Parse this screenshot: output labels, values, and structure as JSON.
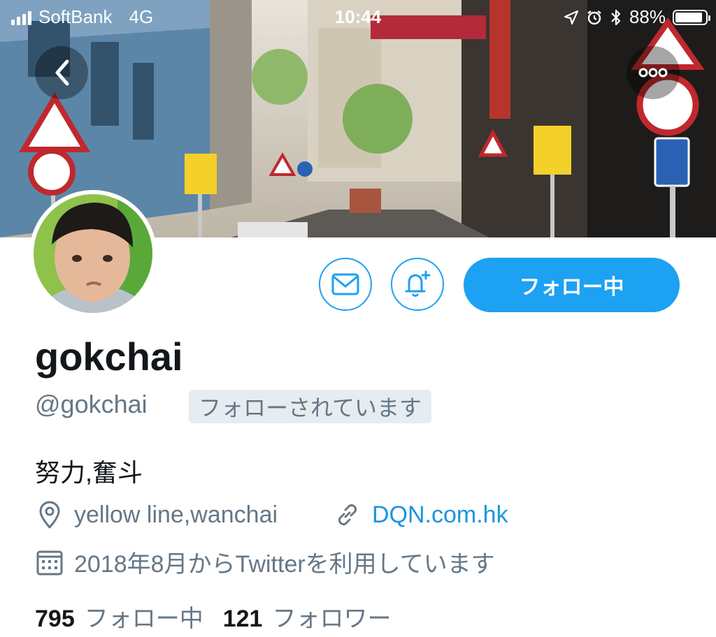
{
  "status_bar": {
    "carrier": "SoftBank",
    "network": "4G",
    "time": "10:44",
    "battery": "88%"
  },
  "profile": {
    "name": "gokchai",
    "handle": "@gokchai",
    "follows_you": "フォローされています",
    "bio": "努力,奮斗",
    "location": "yellow line,wanchai",
    "website": "DQN.com.hk",
    "joined": "2018年8月からTwitterを利用しています",
    "following_count": "795",
    "following_label": "フォロー中",
    "followers_count": "121",
    "followers_label": "フォロワー"
  },
  "actions": {
    "follow_button_label": "フォロー中"
  },
  "colors": {
    "accent": "#1da1f2",
    "link": "#1b95e0",
    "secondary_text": "#657786",
    "primary_text": "#14171a"
  },
  "icons": [
    "back-icon",
    "more-icon",
    "message-icon",
    "notification-add-icon",
    "location-icon",
    "link-icon",
    "calendar-icon"
  ]
}
